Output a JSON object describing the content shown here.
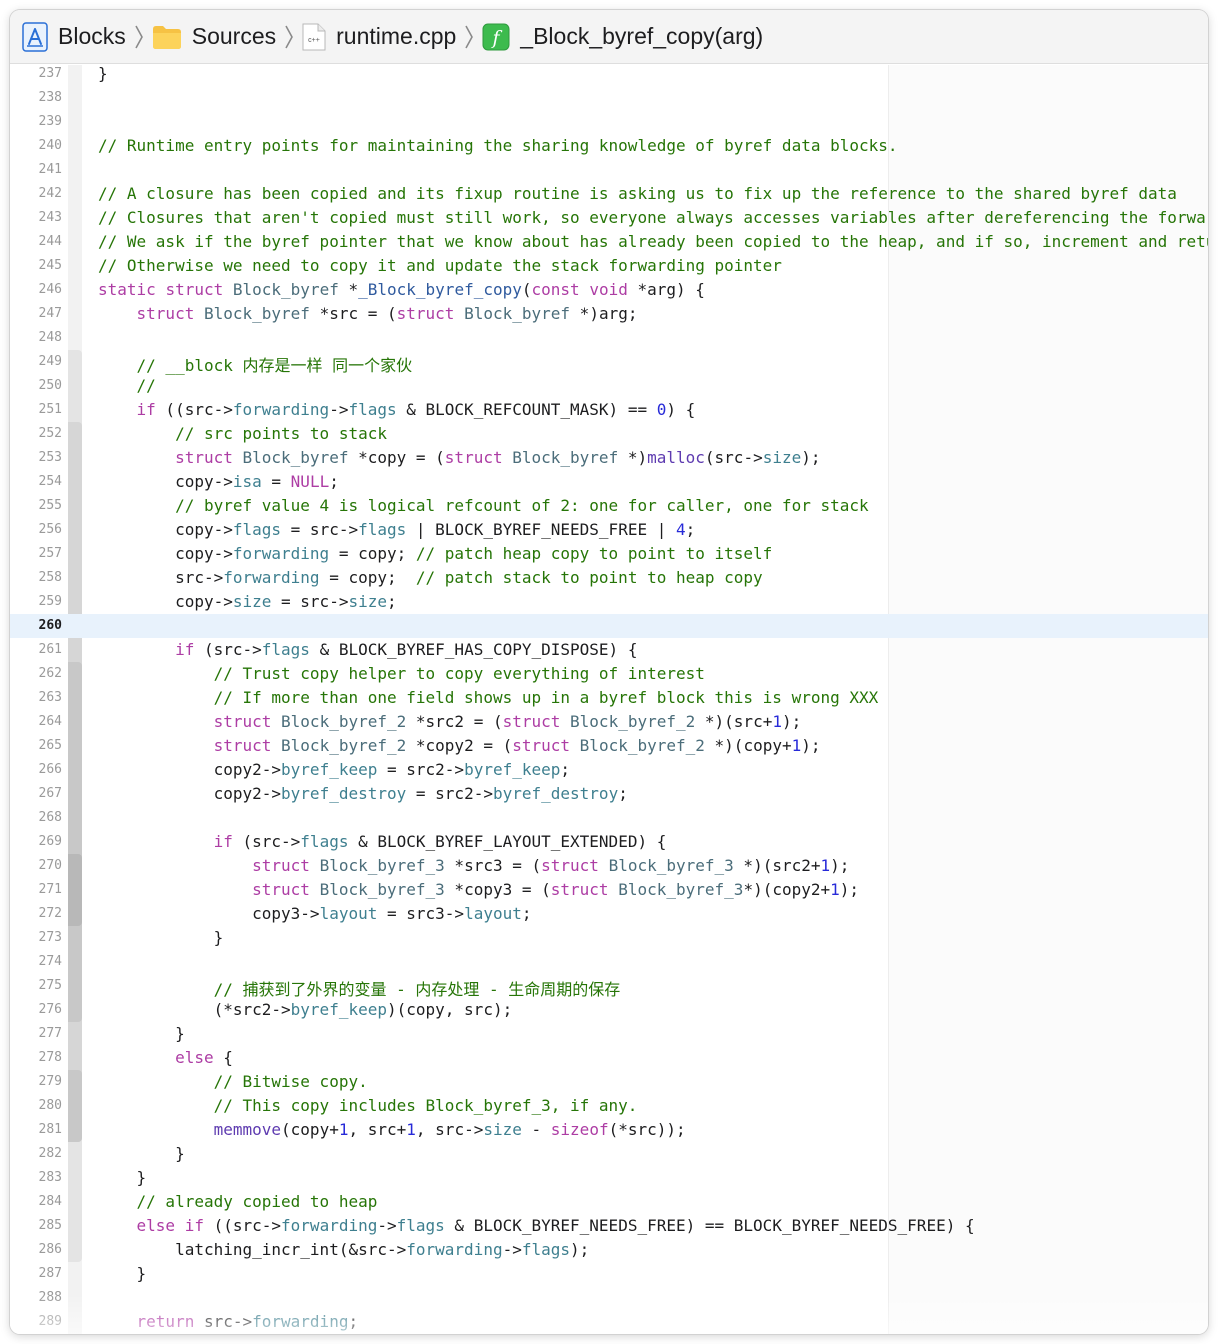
{
  "breadcrumbs": [
    {
      "label": "Blocks",
      "icon": "xcode-project-icon"
    },
    {
      "label": "Sources",
      "icon": "folder-icon"
    },
    {
      "label": "runtime.cpp",
      "icon": "cpp-file-icon",
      "icon_text": "c++"
    },
    {
      "label": "_Block_byref_copy(arg)",
      "icon": "function-icon",
      "icon_text": "f"
    }
  ],
  "colors": {
    "keyword": "#ad3da4",
    "type": "#4b6d7a",
    "function_decl": "#2f5a9e",
    "field": "#3e7f8f",
    "macro_call": "#5e3bb0",
    "number": "#272ad8",
    "comment": "#267507",
    "text": "#1d1d1f",
    "current_line": "#e8f2fc",
    "function_icon_bg": "#3dbb4e",
    "folder_icon": "#f6c244"
  },
  "editor": {
    "current_line": 260,
    "lines": [
      {
        "n": 237,
        "t": [
          [
            "x",
            "}"
          ]
        ]
      },
      {
        "n": 238,
        "t": []
      },
      {
        "n": 239,
        "t": []
      },
      {
        "n": 240,
        "t": [
          [
            "c",
            "// Runtime entry points for maintaining the sharing knowledge of byref data blocks."
          ]
        ]
      },
      {
        "n": 241,
        "t": []
      },
      {
        "n": 242,
        "t": [
          [
            "c",
            "// A closure has been copied and its fixup routine is asking us to fix up the reference to the shared byref data"
          ]
        ]
      },
      {
        "n": 243,
        "t": [
          [
            "c",
            "// Closures that aren't copied must still work, so everyone always accesses variables after dereferencing the forwarding ptr."
          ]
        ]
      },
      {
        "n": 244,
        "t": [
          [
            "c",
            "// We ask if the byref pointer that we know about has already been copied to the heap, and if so, increment and return it."
          ]
        ]
      },
      {
        "n": 245,
        "t": [
          [
            "c",
            "// Otherwise we need to copy it and update the stack forwarding pointer"
          ]
        ]
      },
      {
        "n": 246,
        "t": [
          [
            "k",
            "static"
          ],
          [
            "x",
            " "
          ],
          [
            "k",
            "struct"
          ],
          [
            "x",
            " "
          ],
          [
            "t",
            "Block_byref"
          ],
          [
            "x",
            " *"
          ],
          [
            "f",
            "_Block_byref_copy"
          ],
          [
            "x",
            "("
          ],
          [
            "k",
            "const"
          ],
          [
            "x",
            " "
          ],
          [
            "k",
            "void"
          ],
          [
            "x",
            " *arg) {"
          ]
        ]
      },
      {
        "n": 247,
        "t": [
          [
            "x",
            "    "
          ],
          [
            "k",
            "struct"
          ],
          [
            "x",
            " "
          ],
          [
            "t",
            "Block_byref"
          ],
          [
            "x",
            " *src = ("
          ],
          [
            "k",
            "struct"
          ],
          [
            "x",
            " "
          ],
          [
            "t",
            "Block_byref"
          ],
          [
            "x",
            " *)arg;"
          ]
        ]
      },
      {
        "n": 248,
        "t": []
      },
      {
        "n": 249,
        "t": [
          [
            "x",
            "    "
          ],
          [
            "c",
            "// __block 内存是一样 同一个家伙"
          ]
        ]
      },
      {
        "n": 250,
        "t": [
          [
            "x",
            "    "
          ],
          [
            "c",
            "//"
          ]
        ]
      },
      {
        "n": 251,
        "t": [
          [
            "x",
            "    "
          ],
          [
            "k",
            "if"
          ],
          [
            "x",
            " ((src->"
          ],
          [
            "fd",
            "forwarding"
          ],
          [
            "x",
            "->"
          ],
          [
            "fd",
            "flags"
          ],
          [
            "x",
            " & BLOCK_REFCOUNT_MASK) == "
          ],
          [
            "n",
            "0"
          ],
          [
            "x",
            ") {"
          ]
        ]
      },
      {
        "n": 252,
        "t": [
          [
            "x",
            "        "
          ],
          [
            "c",
            "// src points to stack"
          ]
        ]
      },
      {
        "n": 253,
        "t": [
          [
            "x",
            "        "
          ],
          [
            "k",
            "struct"
          ],
          [
            "x",
            " "
          ],
          [
            "t",
            "Block_byref"
          ],
          [
            "x",
            " *copy = ("
          ],
          [
            "k",
            "struct"
          ],
          [
            "x",
            " "
          ],
          [
            "t",
            "Block_byref"
          ],
          [
            "x",
            " *)"
          ],
          [
            "m",
            "malloc"
          ],
          [
            "x",
            "(src->"
          ],
          [
            "fd",
            "size"
          ],
          [
            "x",
            ");"
          ]
        ]
      },
      {
        "n": 254,
        "t": [
          [
            "x",
            "        copy->"
          ],
          [
            "fd",
            "isa"
          ],
          [
            "x",
            " = "
          ],
          [
            "k",
            "NULL"
          ],
          [
            "x",
            ";"
          ]
        ]
      },
      {
        "n": 255,
        "t": [
          [
            "x",
            "        "
          ],
          [
            "c",
            "// byref value 4 is logical refcount of 2: one for caller, one for stack"
          ]
        ]
      },
      {
        "n": 256,
        "t": [
          [
            "x",
            "        copy->"
          ],
          [
            "fd",
            "flags"
          ],
          [
            "x",
            " = src->"
          ],
          [
            "fd",
            "flags"
          ],
          [
            "x",
            " | BLOCK_BYREF_NEEDS_FREE | "
          ],
          [
            "n",
            "4"
          ],
          [
            "x",
            ";"
          ]
        ]
      },
      {
        "n": 257,
        "t": [
          [
            "x",
            "        copy->"
          ],
          [
            "fd",
            "forwarding"
          ],
          [
            "x",
            " = copy; "
          ],
          [
            "c",
            "// patch heap copy to point to itself"
          ]
        ]
      },
      {
        "n": 258,
        "t": [
          [
            "x",
            "        src->"
          ],
          [
            "fd",
            "forwarding"
          ],
          [
            "x",
            " = copy;  "
          ],
          [
            "c",
            "// patch stack to point to heap copy"
          ]
        ]
      },
      {
        "n": 259,
        "t": [
          [
            "x",
            "        copy->"
          ],
          [
            "fd",
            "size"
          ],
          [
            "x",
            " = src->"
          ],
          [
            "fd",
            "size"
          ],
          [
            "x",
            ";"
          ]
        ]
      },
      {
        "n": 260,
        "t": []
      },
      {
        "n": 261,
        "t": [
          [
            "x",
            "        "
          ],
          [
            "k",
            "if"
          ],
          [
            "x",
            " (src->"
          ],
          [
            "fd",
            "flags"
          ],
          [
            "x",
            " & BLOCK_BYREF_HAS_COPY_DISPOSE) {"
          ]
        ]
      },
      {
        "n": 262,
        "t": [
          [
            "x",
            "            "
          ],
          [
            "c",
            "// Trust copy helper to copy everything of interest"
          ]
        ]
      },
      {
        "n": 263,
        "t": [
          [
            "x",
            "            "
          ],
          [
            "c",
            "// If more than one field shows up in a byref block this is wrong XXX"
          ]
        ]
      },
      {
        "n": 264,
        "t": [
          [
            "x",
            "            "
          ],
          [
            "k",
            "struct"
          ],
          [
            "x",
            " "
          ],
          [
            "t",
            "Block_byref_2"
          ],
          [
            "x",
            " *src2 = ("
          ],
          [
            "k",
            "struct"
          ],
          [
            "x",
            " "
          ],
          [
            "t",
            "Block_byref_2"
          ],
          [
            "x",
            " *)(src+"
          ],
          [
            "n",
            "1"
          ],
          [
            "x",
            ");"
          ]
        ]
      },
      {
        "n": 265,
        "t": [
          [
            "x",
            "            "
          ],
          [
            "k",
            "struct"
          ],
          [
            "x",
            " "
          ],
          [
            "t",
            "Block_byref_2"
          ],
          [
            "x",
            " *copy2 = ("
          ],
          [
            "k",
            "struct"
          ],
          [
            "x",
            " "
          ],
          [
            "t",
            "Block_byref_2"
          ],
          [
            "x",
            " *)(copy+"
          ],
          [
            "n",
            "1"
          ],
          [
            "x",
            ");"
          ]
        ]
      },
      {
        "n": 266,
        "t": [
          [
            "x",
            "            copy2->"
          ],
          [
            "fd",
            "byref_keep"
          ],
          [
            "x",
            " = src2->"
          ],
          [
            "fd",
            "byref_keep"
          ],
          [
            "x",
            ";"
          ]
        ]
      },
      {
        "n": 267,
        "t": [
          [
            "x",
            "            copy2->"
          ],
          [
            "fd",
            "byref_destroy"
          ],
          [
            "x",
            " = src2->"
          ],
          [
            "fd",
            "byref_destroy"
          ],
          [
            "x",
            ";"
          ]
        ]
      },
      {
        "n": 268,
        "t": []
      },
      {
        "n": 269,
        "t": [
          [
            "x",
            "            "
          ],
          [
            "k",
            "if"
          ],
          [
            "x",
            " (src->"
          ],
          [
            "fd",
            "flags"
          ],
          [
            "x",
            " & BLOCK_BYREF_LAYOUT_EXTENDED) {"
          ]
        ]
      },
      {
        "n": 270,
        "t": [
          [
            "x",
            "                "
          ],
          [
            "k",
            "struct"
          ],
          [
            "x",
            " "
          ],
          [
            "t",
            "Block_byref_3"
          ],
          [
            "x",
            " *src3 = ("
          ],
          [
            "k",
            "struct"
          ],
          [
            "x",
            " "
          ],
          [
            "t",
            "Block_byref_3"
          ],
          [
            "x",
            " *)(src2+"
          ],
          [
            "n",
            "1"
          ],
          [
            "x",
            ");"
          ]
        ]
      },
      {
        "n": 271,
        "t": [
          [
            "x",
            "                "
          ],
          [
            "k",
            "struct"
          ],
          [
            "x",
            " "
          ],
          [
            "t",
            "Block_byref_3"
          ],
          [
            "x",
            " *copy3 = ("
          ],
          [
            "k",
            "struct"
          ],
          [
            "x",
            " "
          ],
          [
            "t",
            "Block_byref_3"
          ],
          [
            "x",
            "*)(copy2+"
          ],
          [
            "n",
            "1"
          ],
          [
            "x",
            ");"
          ]
        ]
      },
      {
        "n": 272,
        "t": [
          [
            "x",
            "                copy3->"
          ],
          [
            "fd",
            "layout"
          ],
          [
            "x",
            " = src3->"
          ],
          [
            "fd",
            "layout"
          ],
          [
            "x",
            ";"
          ]
        ]
      },
      {
        "n": 273,
        "t": [
          [
            "x",
            "            }"
          ]
        ]
      },
      {
        "n": 274,
        "t": []
      },
      {
        "n": 275,
        "t": [
          [
            "x",
            "            "
          ],
          [
            "c",
            "// 捕获到了外界的变量 - 内存处理 - 生命周期的保存"
          ]
        ]
      },
      {
        "n": 276,
        "t": [
          [
            "x",
            "            (*src2->"
          ],
          [
            "fd",
            "byref_keep"
          ],
          [
            "x",
            ")(copy, src);"
          ]
        ]
      },
      {
        "n": 277,
        "t": [
          [
            "x",
            "        }"
          ]
        ]
      },
      {
        "n": 278,
        "t": [
          [
            "x",
            "        "
          ],
          [
            "k",
            "else"
          ],
          [
            "x",
            " {"
          ]
        ]
      },
      {
        "n": 279,
        "t": [
          [
            "x",
            "            "
          ],
          [
            "c",
            "// Bitwise copy."
          ]
        ]
      },
      {
        "n": 280,
        "t": [
          [
            "x",
            "            "
          ],
          [
            "c",
            "// This copy includes Block_byref_3, if any."
          ]
        ]
      },
      {
        "n": 281,
        "t": [
          [
            "x",
            "            "
          ],
          [
            "m",
            "memmove"
          ],
          [
            "x",
            "(copy+"
          ],
          [
            "n",
            "1"
          ],
          [
            "x",
            ", src+"
          ],
          [
            "n",
            "1"
          ],
          [
            "x",
            ", src->"
          ],
          [
            "fd",
            "size"
          ],
          [
            "x",
            " - "
          ],
          [
            "k",
            "sizeof"
          ],
          [
            "x",
            "(*src));"
          ]
        ]
      },
      {
        "n": 282,
        "t": [
          [
            "x",
            "        }"
          ]
        ]
      },
      {
        "n": 283,
        "t": [
          [
            "x",
            "    }"
          ]
        ]
      },
      {
        "n": 284,
        "t": [
          [
            "x",
            "    "
          ],
          [
            "c",
            "// already copied to heap"
          ]
        ]
      },
      {
        "n": 285,
        "t": [
          [
            "x",
            "    "
          ],
          [
            "k",
            "else"
          ],
          [
            "x",
            " "
          ],
          [
            "k",
            "if"
          ],
          [
            "x",
            " ((src->"
          ],
          [
            "fd",
            "forwarding"
          ],
          [
            "x",
            "->"
          ],
          [
            "fd",
            "flags"
          ],
          [
            "x",
            " & BLOCK_BYREF_NEEDS_FREE) == BLOCK_BYREF_NEEDS_FREE) {"
          ]
        ]
      },
      {
        "n": 286,
        "t": [
          [
            "x",
            "        latching_incr_int(&src->"
          ],
          [
            "fd",
            "forwarding"
          ],
          [
            "x",
            "->"
          ],
          [
            "fd",
            "flags"
          ],
          [
            "x",
            ");"
          ]
        ]
      },
      {
        "n": 287,
        "t": [
          [
            "x",
            "    }"
          ]
        ]
      },
      {
        "n": 288,
        "t": []
      },
      {
        "n": 289,
        "t": [
          [
            "x",
            "    "
          ],
          [
            "k",
            "return"
          ],
          [
            "x",
            " src->"
          ],
          [
            "fd",
            "forwarding"
          ],
          [
            "x",
            ";"
          ]
        ]
      }
    ]
  }
}
